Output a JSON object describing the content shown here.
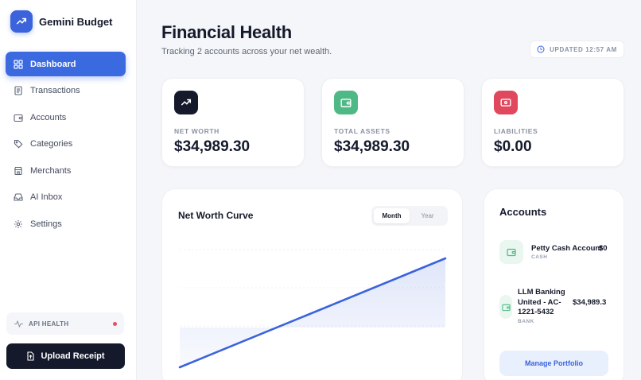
{
  "app": {
    "name": "Gemini Budget",
    "logo_icon": "trending-up-icon",
    "brand_color": "#3b63dc"
  },
  "sidebar": {
    "items": [
      {
        "label": "Dashboard",
        "icon": "grid-icon",
        "active": true
      },
      {
        "label": "Transactions",
        "icon": "receipt-icon",
        "active": false
      },
      {
        "label": "Accounts",
        "icon": "wallet-icon",
        "active": false
      },
      {
        "label": "Categories",
        "icon": "tag-icon",
        "active": false
      },
      {
        "label": "Merchants",
        "icon": "store-icon",
        "active": false
      },
      {
        "label": "AI Inbox",
        "icon": "inbox-icon",
        "active": false
      },
      {
        "label": "Settings",
        "icon": "gear-icon",
        "active": false
      }
    ],
    "api_health": {
      "label": "API HEALTH",
      "status_color": "#ef4b5e"
    },
    "upload_label": "Upload Receipt"
  },
  "header": {
    "title": "Financial Health",
    "subtitle": "Tracking 2 accounts across your net wealth.",
    "updated": "UPDATED 12:57 AM"
  },
  "stats": [
    {
      "label": "NET WORTH",
      "value": "$34,989.30",
      "icon": "trending-up-icon",
      "color": "#141a2b"
    },
    {
      "label": "TOTAL ASSETS",
      "value": "$34,989.30",
      "icon": "wallet-icon",
      "color": "#4fb985"
    },
    {
      "label": "LIABILITIES",
      "value": "$0.00",
      "icon": "credit-card-icon",
      "color": "#e0485d"
    }
  ],
  "chart": {
    "title": "Net Worth Curve",
    "range_options": [
      "Month",
      "Year"
    ],
    "selected_range": "Month",
    "line_color": "#3b63dc"
  },
  "chart_data": {
    "type": "area",
    "series": [
      {
        "values": [
          0,
          34989.3
        ]
      }
    ]
  },
  "accounts": {
    "title": "Accounts",
    "items": [
      {
        "name": "Petty Cash Account",
        "type": "CASH",
        "balance": "$0",
        "icon": "wallet-icon"
      },
      {
        "name_lines": [
          "LLM Banking",
          "United - AC-",
          "1221-5432"
        ],
        "type": "BANK",
        "balance": "$34,989.3",
        "icon": "wallet-icon"
      }
    ],
    "manage_label": "Manage Portfolio"
  }
}
